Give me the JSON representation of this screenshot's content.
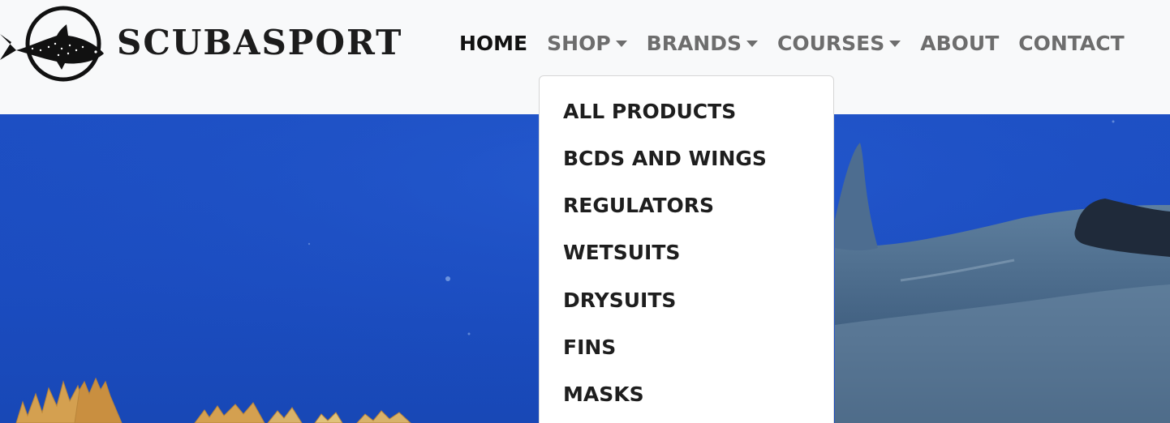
{
  "brand": {
    "name": "SCUBASPORT",
    "logo_icon": "whale-shark-icon"
  },
  "nav": {
    "items": [
      {
        "label": "HOME",
        "active": true,
        "has_dropdown": false
      },
      {
        "label": "SHOP",
        "active": false,
        "has_dropdown": true
      },
      {
        "label": "BRANDS",
        "active": false,
        "has_dropdown": true
      },
      {
        "label": "COURSES",
        "active": false,
        "has_dropdown": true
      },
      {
        "label": "ABOUT",
        "active": false,
        "has_dropdown": false
      },
      {
        "label": "CONTACT",
        "active": false,
        "has_dropdown": false
      }
    ]
  },
  "shop_dropdown": {
    "items": [
      "ALL PRODUCTS",
      "BCDS AND WINGS",
      "REGULATORS",
      "WETSUITS",
      "DRYSUITS",
      "FINS",
      "MASKS"
    ]
  },
  "colors": {
    "navbar_bg": "#f8f9fa",
    "active_link": "#111111",
    "inactive_link": "#6d6d6d",
    "ocean": "#1d4fc4"
  }
}
